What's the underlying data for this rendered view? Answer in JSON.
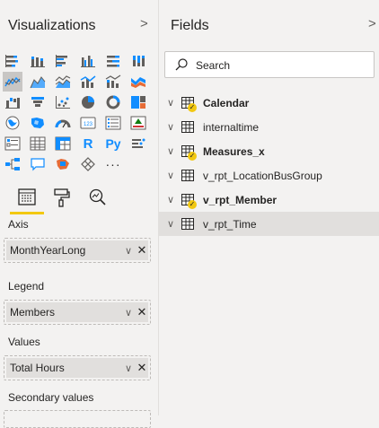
{
  "visualizations": {
    "title": "Visualizations",
    "collapse_chevron": ">",
    "icons": [
      [
        "stacked-bar-icon",
        "stacked-column-icon",
        "clustered-bar-icon",
        "clustered-column-icon",
        "100pct-bar-icon",
        "100pct-column-icon"
      ],
      [
        "line-chart-icon",
        "area-chart-icon",
        "stacked-area-icon",
        "line-clustered-column-icon",
        "line-stacked-column-icon",
        "ribbon-chart-icon"
      ],
      [
        "waterfall-icon",
        "funnel-icon",
        "scatter-icon",
        "pie-chart-icon",
        "donut-chart-icon",
        "treemap-icon"
      ],
      [
        "map-icon",
        "filled-map-icon",
        "gauge-icon",
        "card-icon",
        "multirow-card-icon",
        "kpi-icon"
      ],
      [
        "slicer-icon",
        "table-icon",
        "matrix-icon",
        "r-visual-icon",
        "python-visual-icon",
        "key-influencers-icon"
      ],
      [
        "decomposition-tree-icon",
        "qa-icon",
        "shape-map-icon",
        "custom-visual-icon",
        "more-visuals-icon"
      ]
    ],
    "selected_icon": "line-chart-icon",
    "r_label": "R",
    "py_label": "Py",
    "more_label": "···",
    "tabs": [
      "fields-tab",
      "format-tab",
      "analytics-tab"
    ],
    "wells": [
      {
        "label": "Axis",
        "value": "MonthYearLong"
      },
      {
        "label": "Legend",
        "value": "Members"
      },
      {
        "label": "Values",
        "value": "Total Hours"
      },
      {
        "label": "Secondary values",
        "value": ""
      }
    ],
    "chip_dropdown": "∨",
    "chip_remove": "✕"
  },
  "fields": {
    "title": "Fields",
    "collapse_chevron": ">",
    "search_placeholder": "Search",
    "tables": [
      {
        "name": "Calendar",
        "bold": true,
        "badge": true
      },
      {
        "name": "internaltime",
        "bold": false,
        "badge": false
      },
      {
        "name": "Measures_x",
        "bold": true,
        "badge": true
      },
      {
        "name": "v_rpt_LocationBusGroup",
        "bold": false,
        "badge": false
      },
      {
        "name": "v_rpt_Member",
        "bold": true,
        "badge": true
      },
      {
        "name": "v_rpt_Time",
        "bold": false,
        "badge": false
      }
    ],
    "selected_table": "v_rpt_Time",
    "row_chevron": "∨",
    "badge_mark": "✓"
  },
  "colors": {
    "accent_yellow": "#f2c811",
    "panel_bg": "#f3f2f1",
    "selected_bg": "#e1dfdd",
    "icon_blue": "#118dff",
    "icon_gray": "#605e5c"
  }
}
